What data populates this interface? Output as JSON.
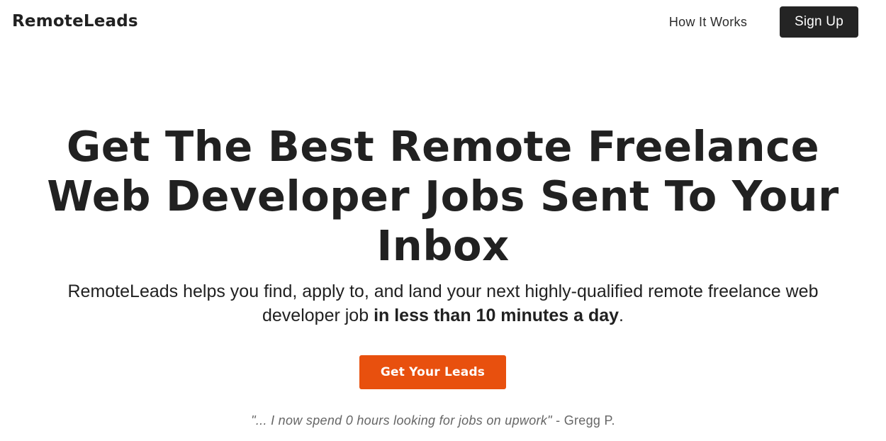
{
  "nav": {
    "logo": "RemoteLeads",
    "how_it_works": "How It Works",
    "sign_up": "Sign Up"
  },
  "hero": {
    "title": "Get The Best Remote Freelance Web Developer Jobs Sent To Your Inbox",
    "subtitle_start": "RemoteLeads helps you find, apply to, and land your next highly-qualified remote freelance web developer job ",
    "subtitle_bold": "in less than 10 minutes a day",
    "subtitle_end": ".",
    "cta_label": "Get Your Leads"
  },
  "testimonial": {
    "quote": "\"... I now spend 0 hours looking for jobs on upwork\"",
    "author": " - Gregg P."
  },
  "colors": {
    "accent": "#e8500e",
    "dark": "#242424",
    "text": "#212121",
    "muted": "#666666"
  }
}
